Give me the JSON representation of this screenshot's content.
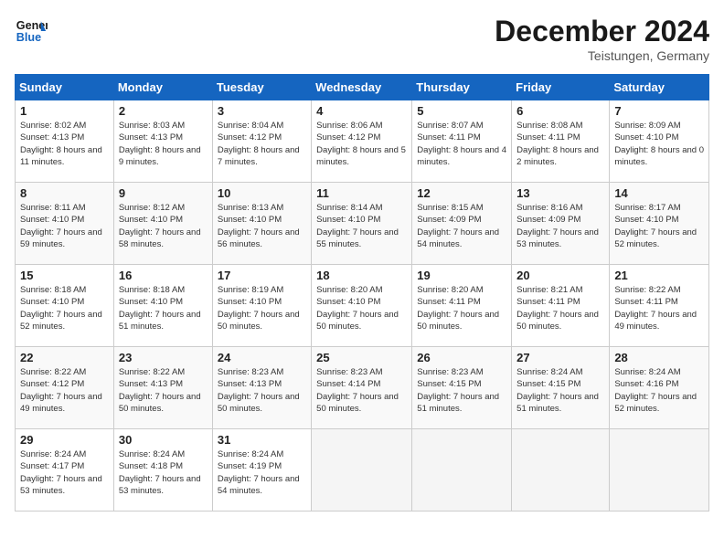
{
  "header": {
    "logo_line1": "General",
    "logo_line2": "Blue",
    "month_title": "December 2024",
    "location": "Teistungen, Germany"
  },
  "weekdays": [
    "Sunday",
    "Monday",
    "Tuesday",
    "Wednesday",
    "Thursday",
    "Friday",
    "Saturday"
  ],
  "weeks": [
    [
      {
        "day": "1",
        "sunrise": "Sunrise: 8:02 AM",
        "sunset": "Sunset: 4:13 PM",
        "daylight": "Daylight: 8 hours and 11 minutes."
      },
      {
        "day": "2",
        "sunrise": "Sunrise: 8:03 AM",
        "sunset": "Sunset: 4:13 PM",
        "daylight": "Daylight: 8 hours and 9 minutes."
      },
      {
        "day": "3",
        "sunrise": "Sunrise: 8:04 AM",
        "sunset": "Sunset: 4:12 PM",
        "daylight": "Daylight: 8 hours and 7 minutes."
      },
      {
        "day": "4",
        "sunrise": "Sunrise: 8:06 AM",
        "sunset": "Sunset: 4:12 PM",
        "daylight": "Daylight: 8 hours and 5 minutes."
      },
      {
        "day": "5",
        "sunrise": "Sunrise: 8:07 AM",
        "sunset": "Sunset: 4:11 PM",
        "daylight": "Daylight: 8 hours and 4 minutes."
      },
      {
        "day": "6",
        "sunrise": "Sunrise: 8:08 AM",
        "sunset": "Sunset: 4:11 PM",
        "daylight": "Daylight: 8 hours and 2 minutes."
      },
      {
        "day": "7",
        "sunrise": "Sunrise: 8:09 AM",
        "sunset": "Sunset: 4:10 PM",
        "daylight": "Daylight: 8 hours and 0 minutes."
      }
    ],
    [
      {
        "day": "8",
        "sunrise": "Sunrise: 8:11 AM",
        "sunset": "Sunset: 4:10 PM",
        "daylight": "Daylight: 7 hours and 59 minutes."
      },
      {
        "day": "9",
        "sunrise": "Sunrise: 8:12 AM",
        "sunset": "Sunset: 4:10 PM",
        "daylight": "Daylight: 7 hours and 58 minutes."
      },
      {
        "day": "10",
        "sunrise": "Sunrise: 8:13 AM",
        "sunset": "Sunset: 4:10 PM",
        "daylight": "Daylight: 7 hours and 56 minutes."
      },
      {
        "day": "11",
        "sunrise": "Sunrise: 8:14 AM",
        "sunset": "Sunset: 4:10 PM",
        "daylight": "Daylight: 7 hours and 55 minutes."
      },
      {
        "day": "12",
        "sunrise": "Sunrise: 8:15 AM",
        "sunset": "Sunset: 4:09 PM",
        "daylight": "Daylight: 7 hours and 54 minutes."
      },
      {
        "day": "13",
        "sunrise": "Sunrise: 8:16 AM",
        "sunset": "Sunset: 4:09 PM",
        "daylight": "Daylight: 7 hours and 53 minutes."
      },
      {
        "day": "14",
        "sunrise": "Sunrise: 8:17 AM",
        "sunset": "Sunset: 4:10 PM",
        "daylight": "Daylight: 7 hours and 52 minutes."
      }
    ],
    [
      {
        "day": "15",
        "sunrise": "Sunrise: 8:18 AM",
        "sunset": "Sunset: 4:10 PM",
        "daylight": "Daylight: 7 hours and 52 minutes."
      },
      {
        "day": "16",
        "sunrise": "Sunrise: 8:18 AM",
        "sunset": "Sunset: 4:10 PM",
        "daylight": "Daylight: 7 hours and 51 minutes."
      },
      {
        "day": "17",
        "sunrise": "Sunrise: 8:19 AM",
        "sunset": "Sunset: 4:10 PM",
        "daylight": "Daylight: 7 hours and 50 minutes."
      },
      {
        "day": "18",
        "sunrise": "Sunrise: 8:20 AM",
        "sunset": "Sunset: 4:10 PM",
        "daylight": "Daylight: 7 hours and 50 minutes."
      },
      {
        "day": "19",
        "sunrise": "Sunrise: 8:20 AM",
        "sunset": "Sunset: 4:11 PM",
        "daylight": "Daylight: 7 hours and 50 minutes."
      },
      {
        "day": "20",
        "sunrise": "Sunrise: 8:21 AM",
        "sunset": "Sunset: 4:11 PM",
        "daylight": "Daylight: 7 hours and 50 minutes."
      },
      {
        "day": "21",
        "sunrise": "Sunrise: 8:22 AM",
        "sunset": "Sunset: 4:11 PM",
        "daylight": "Daylight: 7 hours and 49 minutes."
      }
    ],
    [
      {
        "day": "22",
        "sunrise": "Sunrise: 8:22 AM",
        "sunset": "Sunset: 4:12 PM",
        "daylight": "Daylight: 7 hours and 49 minutes."
      },
      {
        "day": "23",
        "sunrise": "Sunrise: 8:22 AM",
        "sunset": "Sunset: 4:13 PM",
        "daylight": "Daylight: 7 hours and 50 minutes."
      },
      {
        "day": "24",
        "sunrise": "Sunrise: 8:23 AM",
        "sunset": "Sunset: 4:13 PM",
        "daylight": "Daylight: 7 hours and 50 minutes."
      },
      {
        "day": "25",
        "sunrise": "Sunrise: 8:23 AM",
        "sunset": "Sunset: 4:14 PM",
        "daylight": "Daylight: 7 hours and 50 minutes."
      },
      {
        "day": "26",
        "sunrise": "Sunrise: 8:23 AM",
        "sunset": "Sunset: 4:15 PM",
        "daylight": "Daylight: 7 hours and 51 minutes."
      },
      {
        "day": "27",
        "sunrise": "Sunrise: 8:24 AM",
        "sunset": "Sunset: 4:15 PM",
        "daylight": "Daylight: 7 hours and 51 minutes."
      },
      {
        "day": "28",
        "sunrise": "Sunrise: 8:24 AM",
        "sunset": "Sunset: 4:16 PM",
        "daylight": "Daylight: 7 hours and 52 minutes."
      }
    ],
    [
      {
        "day": "29",
        "sunrise": "Sunrise: 8:24 AM",
        "sunset": "Sunset: 4:17 PM",
        "daylight": "Daylight: 7 hours and 53 minutes."
      },
      {
        "day": "30",
        "sunrise": "Sunrise: 8:24 AM",
        "sunset": "Sunset: 4:18 PM",
        "daylight": "Daylight: 7 hours and 53 minutes."
      },
      {
        "day": "31",
        "sunrise": "Sunrise: 8:24 AM",
        "sunset": "Sunset: 4:19 PM",
        "daylight": "Daylight: 7 hours and 54 minutes."
      },
      null,
      null,
      null,
      null
    ]
  ]
}
